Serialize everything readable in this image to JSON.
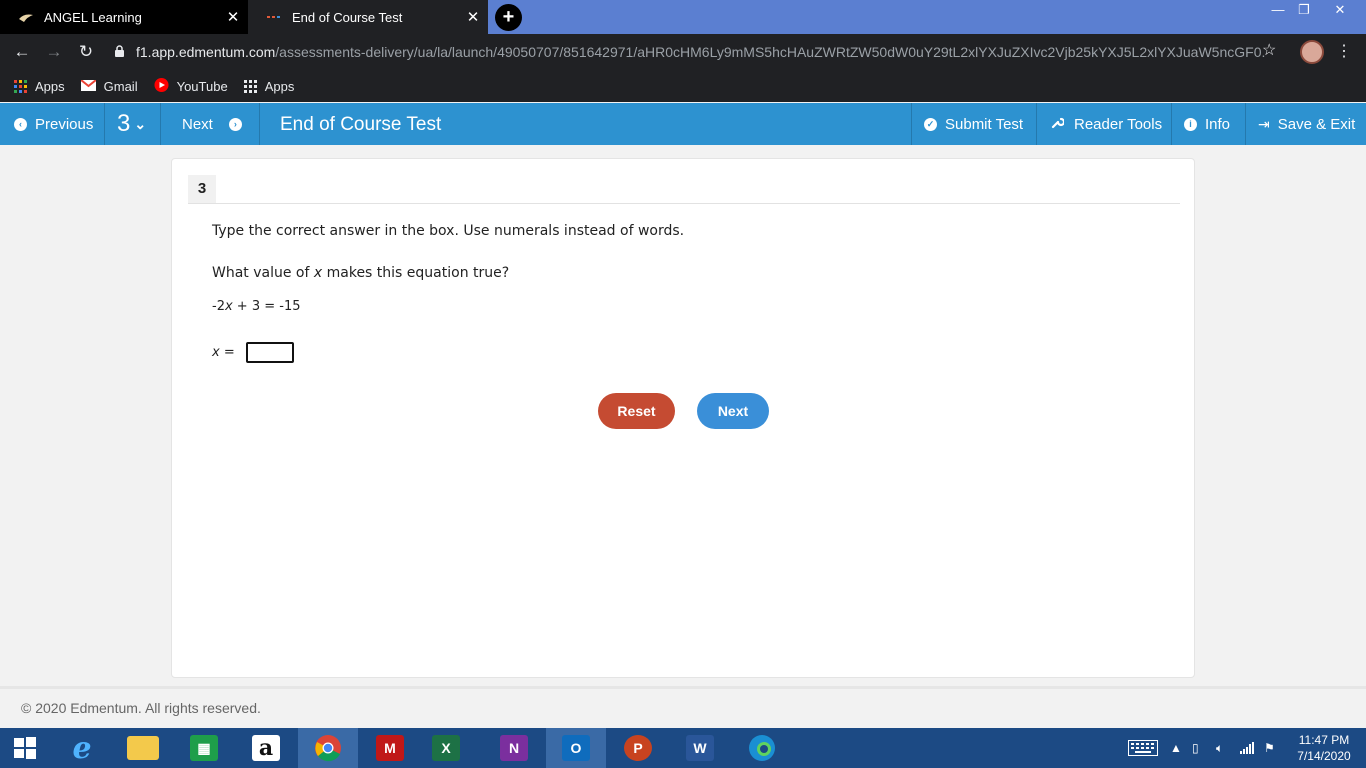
{
  "browser": {
    "tabs": [
      {
        "title": "ANGEL Learning",
        "close": "✕"
      },
      {
        "title": "End of Course Test",
        "close": "✕"
      }
    ],
    "new_tab": "+",
    "window_controls": {
      "minimize": "—",
      "restore": "❐",
      "close": "✕"
    },
    "url_host": "f1.app.edmentum.com",
    "url_path": "/assessments-delivery/ua/la/launch/49050707/851642971/aHR0cHM6Ly9mMS5hcHAuZWRtZW50dW0uY29tL2xlYXJuZXIvc2Vjb25kYXJ5L2xlYXJuaW5ncGF0...",
    "bookmarks": [
      {
        "label": "Apps",
        "icon": "apps-grid-icon"
      },
      {
        "label": "Gmail",
        "icon": "gmail-icon"
      },
      {
        "label": "YouTube",
        "icon": "youtube-icon"
      },
      {
        "label": "Apps",
        "icon": "apps-grid-icon"
      }
    ]
  },
  "toolbar": {
    "previous": "Previous",
    "question_number": "3",
    "next": "Next",
    "title": "End of Course Test",
    "submit": "Submit Test",
    "reader_tools": "Reader Tools",
    "info": "Info",
    "save_exit": "Save & Exit"
  },
  "question": {
    "number": "3",
    "instruction": "Type the correct answer in the box. Use numerals instead of words.",
    "prompt_prefix": "What value of ",
    "prompt_var": "x",
    "prompt_suffix": " makes this equation true?",
    "equation_a": "-2",
    "equation_var": "x",
    "equation_b": " + 3 = -15",
    "answer_var": "x",
    "answer_eq": " =",
    "answer_value": "",
    "reset_label": "Reset",
    "next_label": "Next"
  },
  "footer": {
    "copyright": "© 2020 Edmentum. All rights reserved."
  },
  "taskbar": {
    "time": "11:47 PM",
    "date": "7/14/2020"
  },
  "colors": {
    "toolbar_blue": "#2d92d0",
    "reset_red": "#c54b32",
    "next_blue": "#3a8fd8",
    "taskbar": "#1c4a84"
  }
}
